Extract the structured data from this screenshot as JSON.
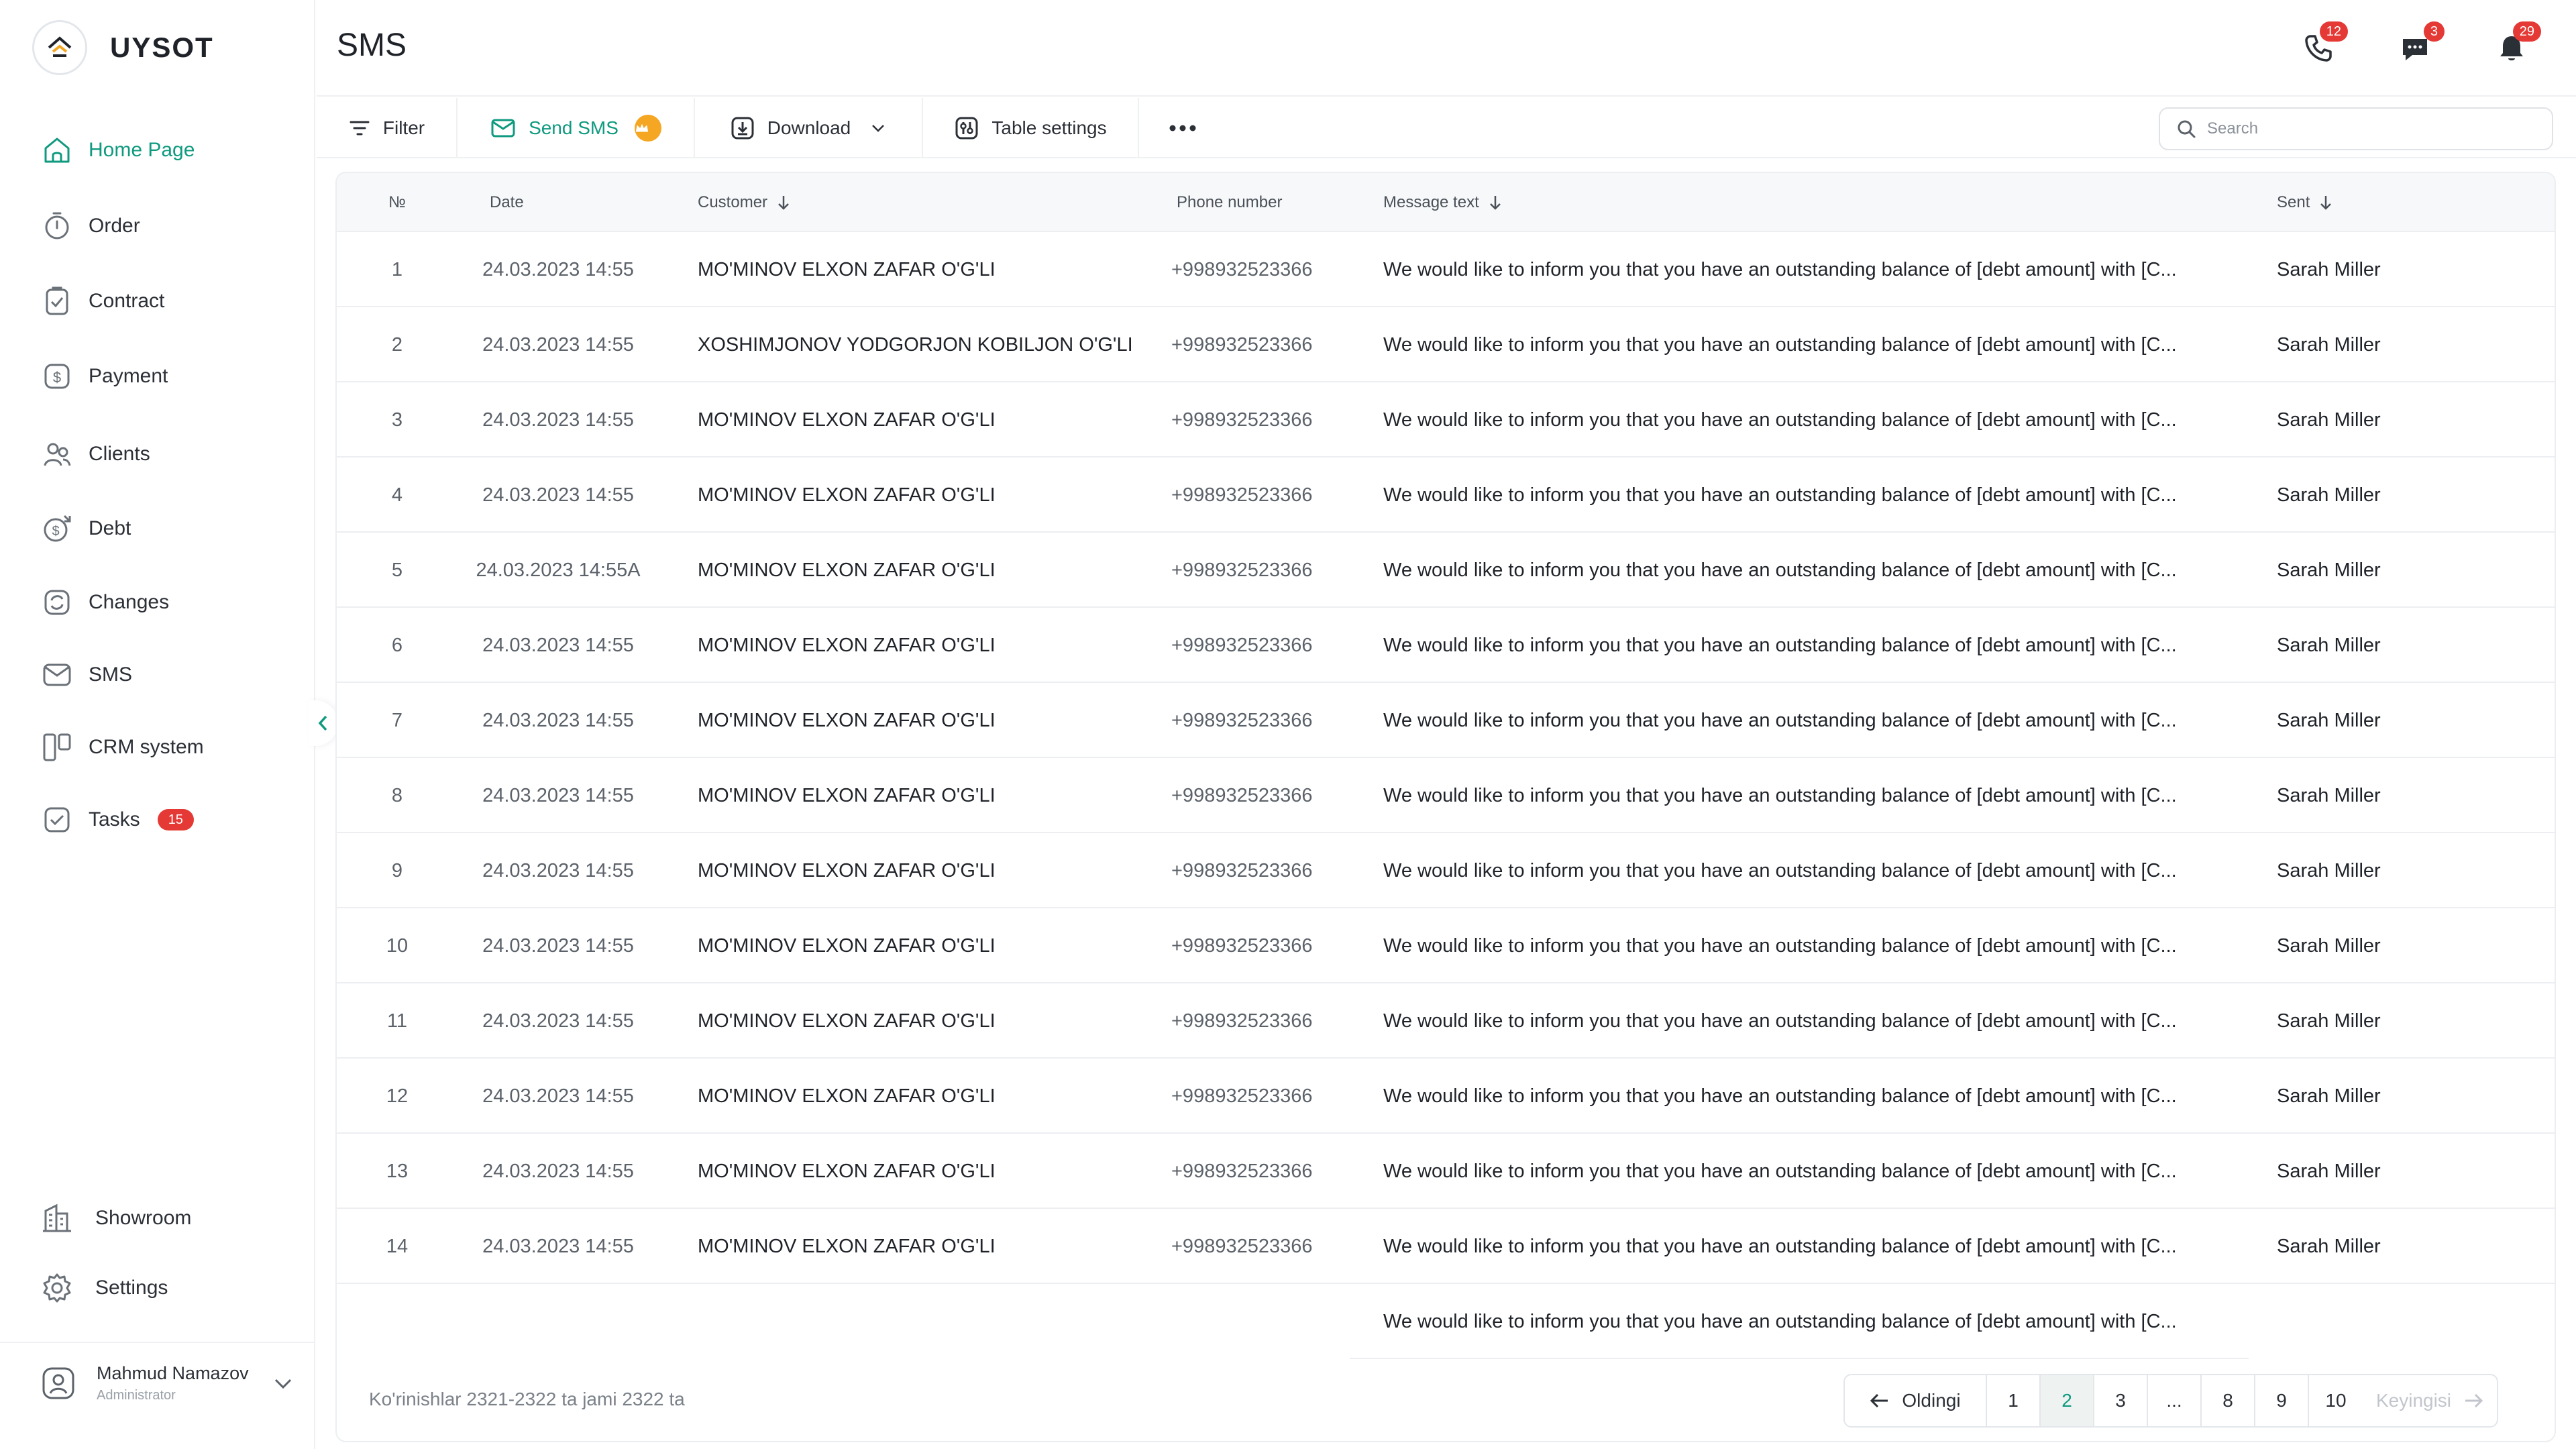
{
  "app": {
    "name": "UYSOT"
  },
  "sidebar": {
    "items": [
      {
        "label": "Home Page",
        "icon": "home-icon",
        "active": true
      },
      {
        "label": "Order",
        "icon": "timer-icon"
      },
      {
        "label": "Contract",
        "icon": "contract-icon"
      },
      {
        "label": "Payment",
        "icon": "dollar-icon"
      },
      {
        "label": "Clients",
        "icon": "users-icon"
      },
      {
        "label": "Debt",
        "icon": "debt-icon"
      },
      {
        "label": "Changes",
        "icon": "changes-icon"
      },
      {
        "label": "SMS",
        "icon": "mail-icon"
      },
      {
        "label": "CRM system",
        "icon": "crm-icon"
      },
      {
        "label": "Tasks",
        "icon": "tasks-icon",
        "badge": "15"
      }
    ],
    "bottom": [
      {
        "label": "Showroom",
        "icon": "showroom-icon"
      },
      {
        "label": "Settings",
        "icon": "settings-icon"
      }
    ],
    "user": {
      "name": "Mahmud Namazov",
      "role": "Administrator"
    }
  },
  "header": {
    "title": "SMS",
    "phone_badge": "12",
    "chat_badge": "3",
    "bell_badge": "29"
  },
  "toolbar": {
    "filter_label": "Filter",
    "send_sms_label": "Send SMS",
    "download_label": "Download",
    "table_settings_label": "Table settings",
    "search_placeholder": "Search"
  },
  "table": {
    "columns": {
      "no": "№",
      "date": "Date",
      "customer": "Customer",
      "phone": "Phone number",
      "message": "Message text",
      "sent": "Sent"
    },
    "rows": [
      {
        "no": "1",
        "date": "24.03.2023 14:55",
        "customer": "MO'MINOV ELXON ZAFAR O'G'LI",
        "phone": "+998932523366",
        "message": "We would like to inform you that you have an outstanding balance of [debt amount] with [C...",
        "sent": "Sarah Miller"
      },
      {
        "no": "2",
        "date": "24.03.2023 14:55",
        "customer": "XOSHIMJONOV YODGORJON KOBILJON O'G'LI",
        "phone": "+998932523366",
        "message": "We would like to inform you that you have an outstanding balance of [debt amount] with [C...",
        "sent": "Sarah Miller"
      },
      {
        "no": "3",
        "date": "24.03.2023 14:55",
        "customer": "MO'MINOV ELXON ZAFAR O'G'LI",
        "phone": "+998932523366",
        "message": "We would like to inform you that you have an outstanding balance of [debt amount] with [C...",
        "sent": "Sarah Miller"
      },
      {
        "no": "4",
        "date": "24.03.2023 14:55",
        "customer": "MO'MINOV ELXON ZAFAR O'G'LI",
        "phone": "+998932523366",
        "message": "We would like to inform you that you have an outstanding balance of [debt amount] with [C...",
        "sent": "Sarah Miller"
      },
      {
        "no": "5",
        "date": "24.03.2023 14:55A",
        "customer": "MO'MINOV ELXON ZAFAR O'G'LI",
        "phone": "+998932523366",
        "message": "We would like to inform you that you have an outstanding balance of [debt amount] with [C...",
        "sent": "Sarah Miller"
      },
      {
        "no": "6",
        "date": "24.03.2023 14:55",
        "customer": "MO'MINOV ELXON ZAFAR O'G'LI",
        "phone": "+998932523366",
        "message": "We would like to inform you that you have an outstanding balance of [debt amount] with [C...",
        "sent": "Sarah Miller"
      },
      {
        "no": "7",
        "date": "24.03.2023 14:55",
        "customer": "MO'MINOV ELXON ZAFAR O'G'LI",
        "phone": "+998932523366",
        "message": "We would like to inform you that you have an outstanding balance of [debt amount] with [C...",
        "sent": "Sarah Miller"
      },
      {
        "no": "8",
        "date": "24.03.2023 14:55",
        "customer": "MO'MINOV ELXON ZAFAR O'G'LI",
        "phone": "+998932523366",
        "message": "We would like to inform you that you have an outstanding balance of [debt amount] with [C...",
        "sent": "Sarah Miller"
      },
      {
        "no": "9",
        "date": "24.03.2023 14:55",
        "customer": "MO'MINOV ELXON ZAFAR O'G'LI",
        "phone": "+998932523366",
        "message": "We would like to inform you that you have an outstanding balance of [debt amount] with [C...",
        "sent": "Sarah Miller"
      },
      {
        "no": "10",
        "date": "24.03.2023 14:55",
        "customer": "MO'MINOV ELXON ZAFAR O'G'LI",
        "phone": "+998932523366",
        "message": "We would like to inform you that you have an outstanding balance of [debt amount] with [C...",
        "sent": "Sarah Miller"
      },
      {
        "no": "11",
        "date": "24.03.2023 14:55",
        "customer": "MO'MINOV ELXON ZAFAR O'G'LI",
        "phone": "+998932523366",
        "message": "We would like to inform you that you have an outstanding balance of [debt amount] with [C...",
        "sent": "Sarah Miller"
      },
      {
        "no": "12",
        "date": "24.03.2023 14:55",
        "customer": "MO'MINOV ELXON ZAFAR O'G'LI",
        "phone": "+998932523366",
        "message": "We would like to inform you that you have an outstanding balance of [debt amount] with [C...",
        "sent": "Sarah Miller"
      },
      {
        "no": "13",
        "date": "24.03.2023 14:55",
        "customer": "MO'MINOV ELXON ZAFAR O'G'LI",
        "phone": "+998932523366",
        "message": "We would like to inform you that you have an outstanding balance of [debt amount] with [C...",
        "sent": "Sarah Miller"
      },
      {
        "no": "14",
        "date": "24.03.2023 14:55",
        "customer": "MO'MINOV ELXON ZAFAR O'G'LI",
        "phone": "+998932523366",
        "message": "We would like to inform you that you have an outstanding balance of [debt amount] with [C...",
        "sent": "Sarah Miller"
      }
    ],
    "extra_message": "We would like to inform you that you have an outstanding balance of [debt amount] with [C..."
  },
  "footer": {
    "info": "Ko'rinishlar 2321-2322 ta jami 2322 ta",
    "prev_label": "Oldingi",
    "next_label": "Keyingisi",
    "pages": [
      "1",
      "2",
      "3",
      "...",
      "8",
      "9",
      "10"
    ],
    "active_page": "2"
  },
  "colors": {
    "accent": "#0f9a7f",
    "badge": "#e53935",
    "crown": "#f5a623"
  }
}
